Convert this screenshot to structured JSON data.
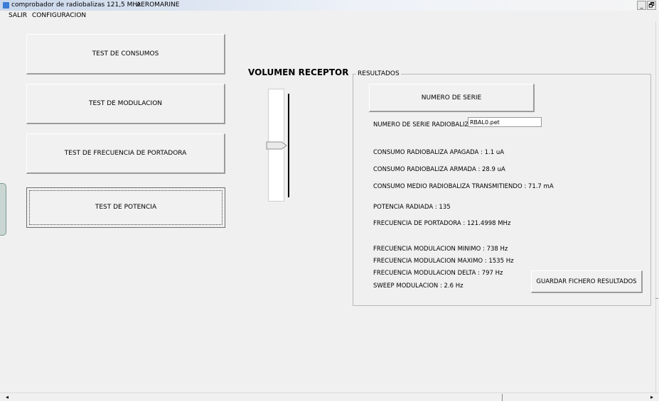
{
  "window": {
    "title": "comprobador de radiobalizas 121,5 MHz",
    "brand": "AEROMARINE",
    "minimize_label": "_",
    "maximize_label": "🗗"
  },
  "menu": {
    "items": [
      {
        "label": "SALIR"
      },
      {
        "label": "CONFIGURACION"
      }
    ]
  },
  "tests": {
    "buttons": [
      {
        "label": "TEST DE CONSUMOS"
      },
      {
        "label": "TEST DE MODULACION"
      },
      {
        "label": "TEST DE FRECUENCIA DE PORTADORA"
      },
      {
        "label": "TEST DE POTENCIA"
      }
    ]
  },
  "volume": {
    "label": "VOLUMEN RECEPTOR",
    "level": 0.5
  },
  "results": {
    "title": "RESULTADOS",
    "serial_button": "NUMERO DE SERIE",
    "serial_label": "NUMERO DE SERIE RADIOBALIZA",
    "serial_value": "RBAL0.pet",
    "lines": [
      "CONSUMO RADIOBALIZA APAGADA : 1.1 uA",
      "CONSUMO RADIOBALIZA ARMADA : 28.9 uA",
      "CONSUMO MEDIO RADIOBALIZA TRANSMITIENDO : 71.7 mA",
      "POTENCIA RADIADA : 135",
      "FRECUENCIA DE PORTADORA : 121.4998 MHz",
      "FRECUENCIA MODULACION MINIMO :  738 Hz",
      "FRECUENCIA MODULACION MAXIMO : 1535 Hz",
      "FRECUENCIA MODULACION DELTA :  797 Hz",
      "SWEEP MODULACION : 2.6 Hz"
    ],
    "save_button": "GUARDAR FICHERO RESULTADOS"
  },
  "scrollbar": {
    "left_arrow": "◂",
    "right_arrow": "▸"
  }
}
